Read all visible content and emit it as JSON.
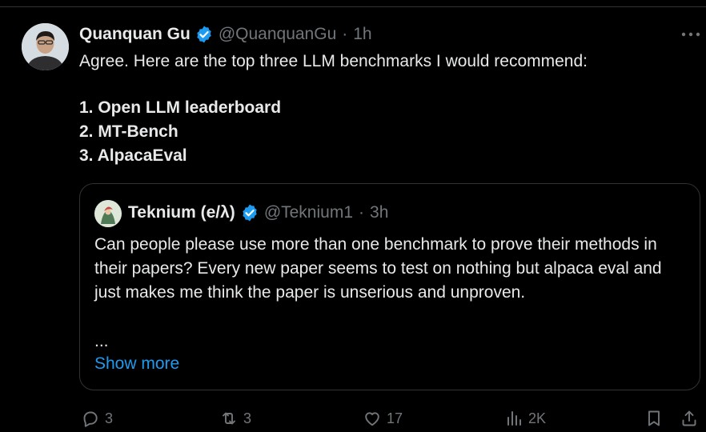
{
  "tweet": {
    "author_name": "Quanquan Gu",
    "handle": "@QuanquanGu",
    "separator": "·",
    "time": "1h",
    "text": "Agree. Here are the top three LLM benchmarks I would recommend:",
    "list": [
      "1. Open LLM leaderboard",
      "2. MT-Bench",
      "3. AlpacaEval"
    ]
  },
  "quote": {
    "author_name": "Teknium (e/λ)",
    "handle": "@Teknium1",
    "separator": "·",
    "time": "3h",
    "text": "Can people please use more than one benchmark to prove their methods in their papers? Every new paper seems to test on nothing but alpaca eval and just makes me think the paper is unserious and unproven.",
    "ellipsis": "...",
    "show_more": "Show more"
  },
  "actions": {
    "replies": "3",
    "reposts": "3",
    "likes": "17",
    "views": "2K"
  },
  "icons": {
    "verified": "verified-badge-icon",
    "more": "more-horizontal-icon",
    "reply": "reply-icon",
    "repost": "repost-icon",
    "like": "heart-icon",
    "views": "views-chart-icon",
    "bookmark": "bookmark-icon",
    "share": "share-icon"
  },
  "colors": {
    "background": "#000000",
    "text": "#e7e9ea",
    "muted": "#71767b",
    "accent": "#1d9bf0",
    "border": "#2f3336"
  }
}
